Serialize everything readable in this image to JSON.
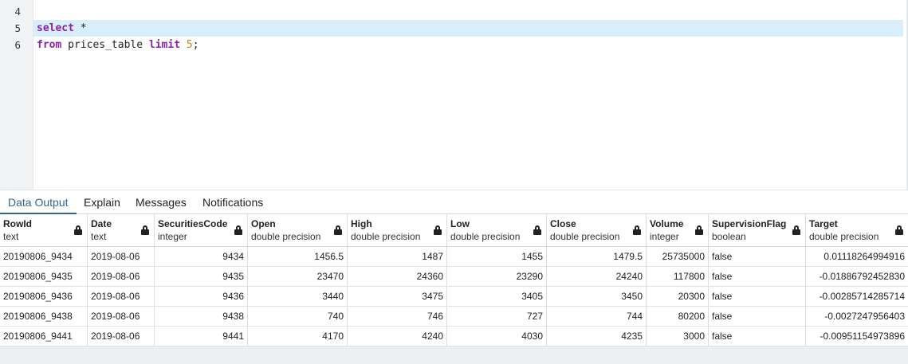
{
  "editor": {
    "lines": [
      {
        "number": "4",
        "text": ""
      },
      {
        "number": "5",
        "keyword": "select",
        "rest": " *"
      },
      {
        "number": "6",
        "keyword": "from",
        "middle": " prices_table ",
        "keyword2": "limit",
        "space": " ",
        "number_literal": "5",
        "end": ";"
      }
    ]
  },
  "tabs": [
    "Data Output",
    "Explain",
    "Messages",
    "Notifications"
  ],
  "columns": [
    {
      "name": "RowId",
      "type": "text"
    },
    {
      "name": "Date",
      "type": "text"
    },
    {
      "name": "SecuritiesCode",
      "type": "integer"
    },
    {
      "name": "Open",
      "type": "double precision"
    },
    {
      "name": "High",
      "type": "double precision"
    },
    {
      "name": "Low",
      "type": "double precision"
    },
    {
      "name": "Close",
      "type": "double precision"
    },
    {
      "name": "Volume",
      "type": "integer"
    },
    {
      "name": "SupervisionFlag",
      "type": "boolean"
    },
    {
      "name": "Target",
      "type": "double precision"
    }
  ],
  "rows": [
    [
      "20190806_9434",
      "2019-08-06",
      "9434",
      "1456.5",
      "1487",
      "1455",
      "1479.5",
      "25735000",
      "false",
      "0.01118264994916"
    ],
    [
      "20190806_9435",
      "2019-08-06",
      "9435",
      "23470",
      "24360",
      "23290",
      "24240",
      "117800",
      "false",
      "-0.01886792452830"
    ],
    [
      "20190806_9436",
      "2019-08-06",
      "9436",
      "3440",
      "3475",
      "3405",
      "3450",
      "20300",
      "false",
      "-0.00285714285714"
    ],
    [
      "20190806_9438",
      "2019-08-06",
      "9438",
      "740",
      "746",
      "727",
      "744",
      "80200",
      "false",
      "-0.0027247956403"
    ],
    [
      "20190806_9441",
      "2019-08-06",
      "9441",
      "4170",
      "4240",
      "4030",
      "4235",
      "3000",
      "false",
      "-0.00951154973896"
    ]
  ],
  "colors": {
    "accent": "#326690",
    "keyword": "#8b1fa9",
    "number": "#c58a1a",
    "highlight": "#d9eefb"
  }
}
